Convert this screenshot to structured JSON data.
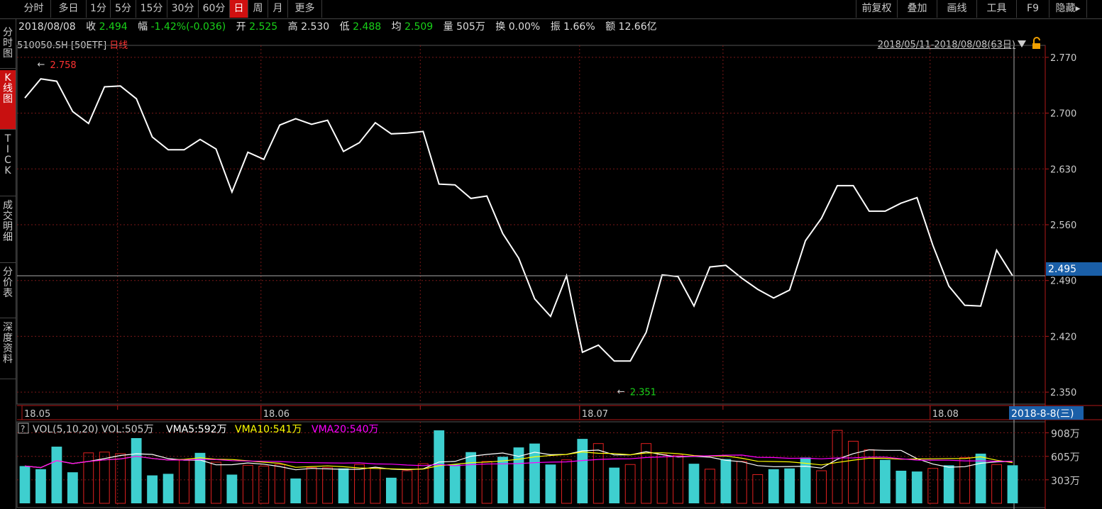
{
  "toolbar": {
    "periods": [
      "分时",
      "多日",
      "1分",
      "5分",
      "15分",
      "30分",
      "60分",
      "日",
      "周",
      "月",
      "更多"
    ],
    "active_period": "日",
    "right": [
      "前复权",
      "叠加",
      "画线",
      "工具",
      "F9",
      "隐藏▸"
    ]
  },
  "sidebar": [
    {
      "label": "分时图",
      "active": false
    },
    {
      "label": "K线图",
      "active": true
    },
    {
      "label": "TICK",
      "active": false
    },
    {
      "label": "成交明细",
      "active": false
    },
    {
      "label": "分价表",
      "active": false
    },
    {
      "label": "深度资料",
      "active": false
    }
  ],
  "info": {
    "date": "2018/08/08",
    "close_label": "收",
    "close": "2.494",
    "change_label": "幅",
    "change": "-1.42%(-0.036)",
    "open_label": "开",
    "open": "2.525",
    "high_label": "高",
    "high": "2.530",
    "low_label": "低",
    "low": "2.488",
    "avg_label": "均",
    "avg": "2.509",
    "volume_label": "量",
    "volume": "505万",
    "turnover_label": "换",
    "turnover": "0.00%",
    "amplitude_label": "振",
    "amplitude": "1.66%",
    "amount_label": "额",
    "amount": "12.66亿"
  },
  "symbol": "510050.SH [50ETF]",
  "chart_kind": "日线",
  "date_range": "2018/05/11-2018/08/08(63日)",
  "cursor_price": "2.495",
  "cursor_date": "2018-8-8(三)",
  "colors": {
    "up": "#ff3232",
    "down": "#19d219",
    "vol_up": "#e02020",
    "vol_down": "#3ecfcf",
    "ma5": "#ffffff",
    "ma10": "#ffff00",
    "ma20": "#ff00ff"
  },
  "chart_data": [
    {
      "type": "line",
      "ylim": [
        2.335,
        2.785
      ],
      "yticks": [
        "2.770",
        "2.700",
        "2.630",
        "2.560",
        "2.490",
        "2.420",
        "2.350"
      ],
      "xticks": [
        {
          "label": "18.05",
          "index": 0
        },
        {
          "label": "18.06",
          "index": 15
        },
        {
          "label": "18.07",
          "index": 35
        },
        {
          "label": "18.08",
          "index": 57
        }
      ],
      "max_marker": "2.758",
      "min_marker": "2.351",
      "series": [
        {
          "values": [
            2.719,
            2.743,
            2.74,
            2.702,
            2.687,
            2.733,
            2.734,
            2.718,
            2.67,
            2.654,
            2.654,
            2.667,
            2.655,
            2.601,
            2.651,
            2.642,
            2.685,
            2.693,
            2.686,
            2.691,
            2.652,
            2.663,
            2.688,
            2.674,
            2.675,
            2.677,
            2.611,
            2.61,
            2.593,
            2.596,
            2.549,
            2.518,
            2.467,
            2.445,
            2.496,
            2.4,
            2.409,
            2.389,
            2.389,
            2.425,
            2.497,
            2.495,
            2.458,
            2.507,
            2.509,
            2.493,
            2.479,
            2.468,
            2.478,
            2.54,
            2.568,
            2.609,
            2.609,
            2.577,
            2.577,
            2.587,
            2.594,
            2.534,
            2.483,
            2.459,
            2.458,
            2.528,
            2.496
          ]
        }
      ]
    },
    {
      "type": "bar",
      "title": "VOL(5,10,20) VOL:505万",
      "legend": [
        {
          "name": "VMA5:592万"
        },
        {
          "name": "VMA10:541万"
        },
        {
          "name": "VMA20:540万"
        }
      ],
      "yticks": [
        "908万",
        "605万",
        "303万"
      ],
      "ylim": [
        0,
        1050
      ],
      "values": [
        480,
        440,
        730,
        400,
        650,
        660,
        640,
        840,
        360,
        380,
        560,
        650,
        530,
        370,
        490,
        480,
        500,
        320,
        460,
        460,
        450,
        500,
        460,
        330,
        420,
        510,
        940,
        500,
        660,
        540,
        600,
        720,
        770,
        500,
        560,
        830,
        770,
        460,
        500,
        770,
        630,
        620,
        510,
        440,
        570,
        540,
        370,
        440,
        450,
        590,
        420,
        940,
        800,
        690,
        560,
        420,
        410,
        450,
        490,
        590,
        640,
        500,
        490
      ],
      "up": [
        false,
        false,
        false,
        false,
        true,
        true,
        true,
        false,
        false,
        false,
        true,
        false,
        true,
        false,
        true,
        true,
        true,
        false,
        true,
        true,
        false,
        true,
        true,
        false,
        true,
        true,
        false,
        false,
        false,
        true,
        false,
        false,
        false,
        false,
        true,
        false,
        true,
        false,
        true,
        true,
        true,
        true,
        false,
        true,
        false,
        true,
        true,
        false,
        false,
        false,
        true,
        true,
        true,
        true,
        false,
        false,
        false,
        true,
        false,
        true,
        false,
        true,
        false
      ]
    }
  ]
}
